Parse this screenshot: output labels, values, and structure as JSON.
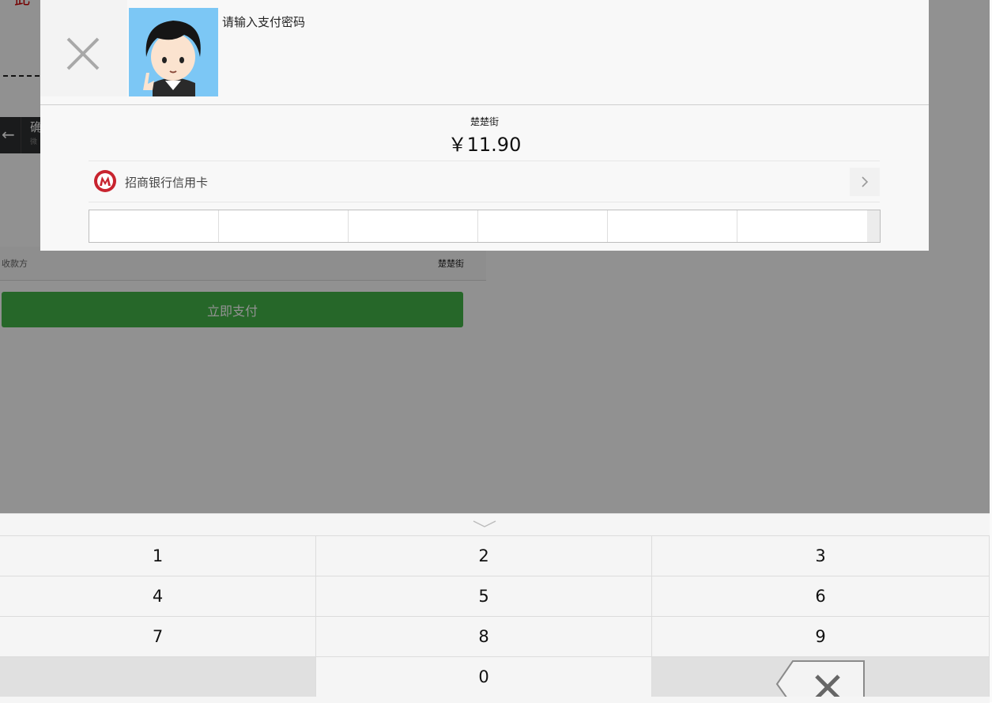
{
  "background": {
    "merchant_row": {
      "label": "收款方",
      "value": "楚楚街"
    },
    "pay_button_label": "立即支付",
    "back_icon": "arrow-left-icon"
  },
  "dialog": {
    "close_icon": "close-icon",
    "avatar": "avatar-cartoon-boy",
    "prompt": "请输入支付密码",
    "merchant": "楚楚街",
    "amount": "￥11.90",
    "payment_method": {
      "bank_icon": "cmb-bank-logo-icon",
      "name": "招商银行信用卡",
      "chevron_icon": "chevron-right-icon"
    },
    "password_cells": 6
  },
  "keypad": {
    "collapse_icon": "chevron-down-icon",
    "keys": [
      "1",
      "2",
      "3",
      "4",
      "5",
      "6",
      "7",
      "8",
      "9",
      "",
      "0",
      "delete"
    ],
    "delete_icon": "backspace-icon"
  },
  "colors": {
    "pay_button": "#44b549",
    "bank_red": "#c8242f",
    "overlay": "rgba(0,0,0,0.43)"
  }
}
